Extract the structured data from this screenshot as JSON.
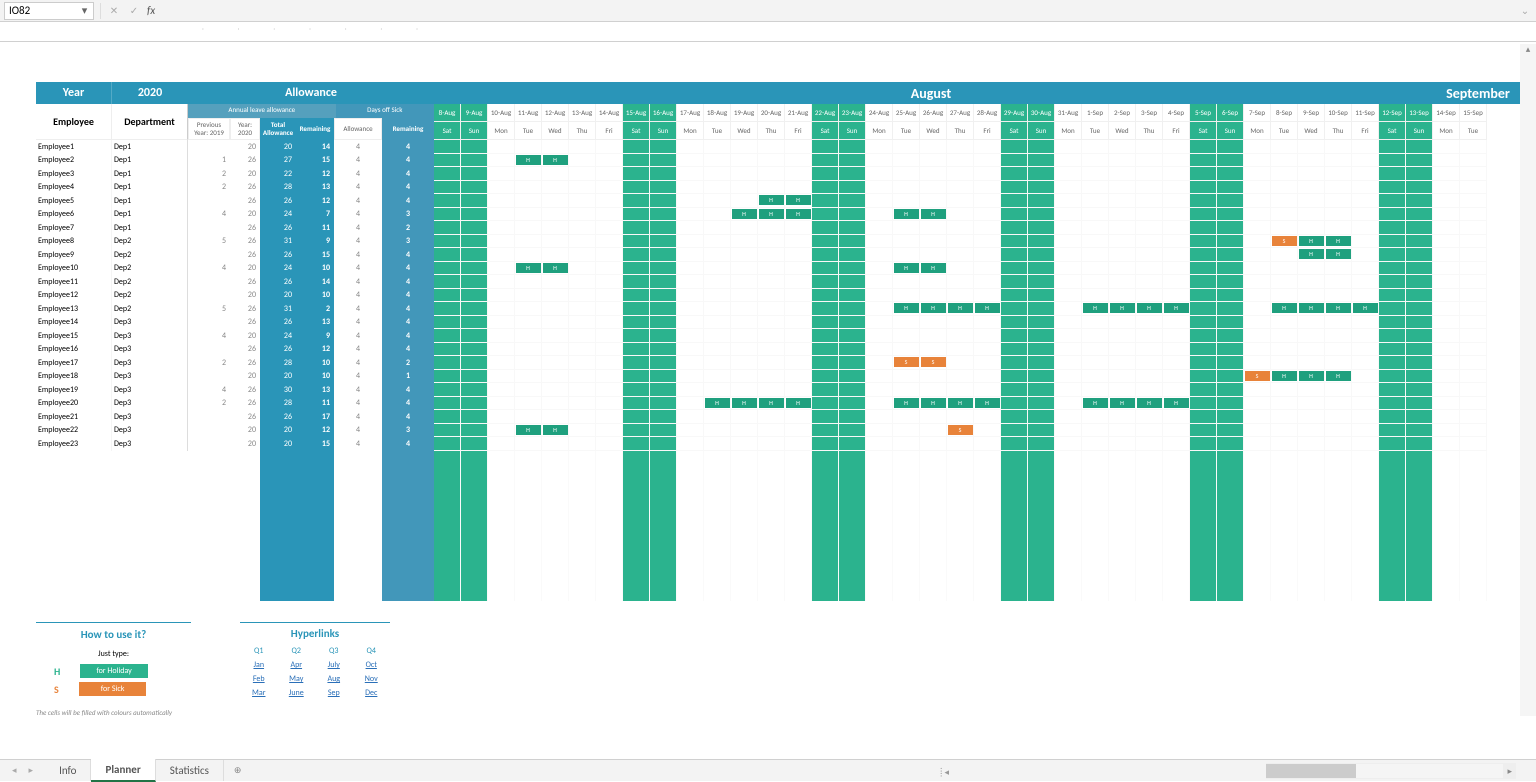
{
  "formula_bar": {
    "cell_ref": "IO82",
    "fx": "fx"
  },
  "header": {
    "year_label": "Year",
    "year_value": "2020",
    "allowance": "Allowance",
    "august": "August",
    "september": "September"
  },
  "sub": {
    "employee": "Employee",
    "department": "Department",
    "ala": "Annual leave allowance",
    "dos": "Days off Sick",
    "prev": "Previous Year: 2019",
    "y20": "Year: 2020",
    "tot": "Total Allowance",
    "rem": "Remaining",
    "sall": "Allowance",
    "srem": "Remaining"
  },
  "dates": [
    "8-Aug",
    "9-Aug",
    "10-Aug",
    "11-Aug",
    "12-Aug",
    "13-Aug",
    "14-Aug",
    "15-Aug",
    "16-Aug",
    "17-Aug",
    "18-Aug",
    "19-Aug",
    "20-Aug",
    "21-Aug",
    "22-Aug",
    "23-Aug",
    "24-Aug",
    "25-Aug",
    "26-Aug",
    "27-Aug",
    "28-Aug",
    "29-Aug",
    "30-Aug",
    "31-Aug",
    "1-Sep",
    "2-Sep",
    "3-Sep",
    "4-Sep",
    "5-Sep",
    "6-Sep",
    "7-Sep",
    "8-Sep",
    "9-Sep",
    "10-Sep",
    "11-Sep",
    "12-Sep",
    "13-Sep",
    "14-Sep",
    "15-Sep"
  ],
  "dows": [
    "Sat",
    "Sun",
    "Mon",
    "Tue",
    "Wed",
    "Thu",
    "Fri",
    "Sat",
    "Sun",
    "Mon",
    "Tue",
    "Wed",
    "Thu",
    "Fri",
    "Sat",
    "Sun",
    "Mon",
    "Tue",
    "Wed",
    "Thu",
    "Fri",
    "Sat",
    "Sun",
    "Mon",
    "Tue",
    "Wed",
    "Thu",
    "Fri",
    "Sat",
    "Sun",
    "Mon",
    "Tue",
    "Wed",
    "Thu",
    "Fri",
    "Sat",
    "Sun",
    "Mon",
    "Tue"
  ],
  "wknd_idx": [
    0,
    1,
    7,
    8,
    14,
    15,
    21,
    22,
    28,
    29,
    35,
    36
  ],
  "employees": [
    {
      "name": "Employee1",
      "dep": "Dep1",
      "prev": "",
      "y20": 20,
      "tot": 20,
      "rem": 14,
      "sa": 4,
      "sr": 4,
      "marks": []
    },
    {
      "name": "Employee2",
      "dep": "Dep1",
      "prev": 1,
      "y20": 26,
      "tot": 27,
      "rem": 15,
      "sa": 4,
      "sr": 4,
      "marks": [
        {
          "i": 3,
          "t": "H"
        },
        {
          "i": 4,
          "t": "H"
        }
      ]
    },
    {
      "name": "Employee3",
      "dep": "Dep1",
      "prev": 2,
      "y20": 20,
      "tot": 22,
      "rem": 12,
      "sa": 4,
      "sr": 4,
      "marks": []
    },
    {
      "name": "Employee4",
      "dep": "Dep1",
      "prev": 2,
      "y20": 26,
      "tot": 28,
      "rem": 13,
      "sa": 4,
      "sr": 4,
      "marks": []
    },
    {
      "name": "Employee5",
      "dep": "Dep1",
      "prev": "",
      "y20": 26,
      "tot": 26,
      "rem": 12,
      "sa": 4,
      "sr": 4,
      "marks": [
        {
          "i": 12,
          "t": "H"
        },
        {
          "i": 13,
          "t": "H"
        }
      ]
    },
    {
      "name": "Employee6",
      "dep": "Dep1",
      "prev": 4,
      "y20": 20,
      "tot": 24,
      "rem": 7,
      "sa": 4,
      "sr": 3,
      "marks": [
        {
          "i": 11,
          "t": "H"
        },
        {
          "i": 12,
          "t": "H"
        },
        {
          "i": 13,
          "t": "H"
        },
        {
          "i": 17,
          "t": "H"
        },
        {
          "i": 18,
          "t": "H"
        }
      ]
    },
    {
      "name": "Employee7",
      "dep": "Dep1",
      "prev": "",
      "y20": 26,
      "tot": 26,
      "rem": 11,
      "sa": 4,
      "sr": 2,
      "marks": []
    },
    {
      "name": "Employee8",
      "dep": "Dep2",
      "prev": 5,
      "y20": 26,
      "tot": 31,
      "rem": 9,
      "sa": 4,
      "sr": 3,
      "marks": [
        {
          "i": 31,
          "t": "S"
        },
        {
          "i": 32,
          "t": "H"
        },
        {
          "i": 33,
          "t": "H"
        }
      ]
    },
    {
      "name": "Employee9",
      "dep": "Dep2",
      "prev": "",
      "y20": 26,
      "tot": 26,
      "rem": 15,
      "sa": 4,
      "sr": 4,
      "marks": [
        {
          "i": 32,
          "t": "H"
        },
        {
          "i": 33,
          "t": "H"
        }
      ]
    },
    {
      "name": "Employee10",
      "dep": "Dep2",
      "prev": 4,
      "y20": 20,
      "tot": 24,
      "rem": 10,
      "sa": 4,
      "sr": 4,
      "marks": [
        {
          "i": 3,
          "t": "H"
        },
        {
          "i": 4,
          "t": "H"
        },
        {
          "i": 17,
          "t": "H"
        },
        {
          "i": 18,
          "t": "H"
        }
      ]
    },
    {
      "name": "Employee11",
      "dep": "Dep2",
      "prev": "",
      "y20": 26,
      "tot": 26,
      "rem": 14,
      "sa": 4,
      "sr": 4,
      "marks": []
    },
    {
      "name": "Employee12",
      "dep": "Dep2",
      "prev": "",
      "y20": 20,
      "tot": 20,
      "rem": 10,
      "sa": 4,
      "sr": 4,
      "marks": []
    },
    {
      "name": "Employee13",
      "dep": "Dep2",
      "prev": 5,
      "y20": 26,
      "tot": 31,
      "rem": 2,
      "sa": 4,
      "sr": 4,
      "marks": [
        {
          "i": 17,
          "t": "H"
        },
        {
          "i": 18,
          "t": "H"
        },
        {
          "i": 19,
          "t": "H"
        },
        {
          "i": 20,
          "t": "H"
        },
        {
          "i": 24,
          "t": "H"
        },
        {
          "i": 25,
          "t": "H"
        },
        {
          "i": 26,
          "t": "H"
        },
        {
          "i": 27,
          "t": "H"
        },
        {
          "i": 31,
          "t": "H"
        },
        {
          "i": 32,
          "t": "H"
        },
        {
          "i": 33,
          "t": "H"
        },
        {
          "i": 34,
          "t": "H"
        }
      ]
    },
    {
      "name": "Employee14",
      "dep": "Dep3",
      "prev": "",
      "y20": 26,
      "tot": 26,
      "rem": 13,
      "sa": 4,
      "sr": 4,
      "marks": []
    },
    {
      "name": "Employee15",
      "dep": "Dep3",
      "prev": 4,
      "y20": 20,
      "tot": 24,
      "rem": 9,
      "sa": 4,
      "sr": 4,
      "marks": []
    },
    {
      "name": "Employee16",
      "dep": "Dep3",
      "prev": "",
      "y20": 26,
      "tot": 26,
      "rem": 12,
      "sa": 4,
      "sr": 4,
      "marks": []
    },
    {
      "name": "Employee17",
      "dep": "Dep3",
      "prev": 2,
      "y20": 26,
      "tot": 28,
      "rem": 10,
      "sa": 4,
      "sr": 2,
      "marks": [
        {
          "i": 17,
          "t": "S"
        },
        {
          "i": 18,
          "t": "S"
        }
      ]
    },
    {
      "name": "Employee18",
      "dep": "Dep3",
      "prev": "",
      "y20": 20,
      "tot": 20,
      "rem": 10,
      "sa": 4,
      "sr": 1,
      "marks": [
        {
          "i": 30,
          "t": "S"
        },
        {
          "i": 31,
          "t": "H"
        },
        {
          "i": 32,
          "t": "H"
        },
        {
          "i": 33,
          "t": "H"
        }
      ]
    },
    {
      "name": "Employee19",
      "dep": "Dep3",
      "prev": 4,
      "y20": 26,
      "tot": 30,
      "rem": 13,
      "sa": 4,
      "sr": 4,
      "marks": []
    },
    {
      "name": "Employee20",
      "dep": "Dep3",
      "prev": 2,
      "y20": 26,
      "tot": 28,
      "rem": 11,
      "sa": 4,
      "sr": 4,
      "marks": [
        {
          "i": 10,
          "t": "H"
        },
        {
          "i": 11,
          "t": "H"
        },
        {
          "i": 12,
          "t": "H"
        },
        {
          "i": 13,
          "t": "H"
        },
        {
          "i": 17,
          "t": "H"
        },
        {
          "i": 18,
          "t": "H"
        },
        {
          "i": 19,
          "t": "H"
        },
        {
          "i": 20,
          "t": "H"
        },
        {
          "i": 24,
          "t": "H"
        },
        {
          "i": 25,
          "t": "H"
        },
        {
          "i": 26,
          "t": "H"
        },
        {
          "i": 27,
          "t": "H"
        }
      ]
    },
    {
      "name": "Employee21",
      "dep": "Dep3",
      "prev": "",
      "y20": 26,
      "tot": 26,
      "rem": 17,
      "sa": 4,
      "sr": 4,
      "marks": []
    },
    {
      "name": "Employee22",
      "dep": "Dep3",
      "prev": "",
      "y20": 20,
      "tot": 20,
      "rem": 12,
      "sa": 4,
      "sr": 3,
      "marks": [
        {
          "i": 3,
          "t": "H"
        },
        {
          "i": 4,
          "t": "H"
        },
        {
          "i": 19,
          "t": "S"
        }
      ]
    },
    {
      "name": "Employee23",
      "dep": "Dep3",
      "prev": "",
      "y20": 20,
      "tot": 20,
      "rem": 15,
      "sa": 4,
      "sr": 4,
      "marks": []
    }
  ],
  "legend": {
    "title": "How to use it?",
    "just_type": "Just type:",
    "h": "H",
    "h_label": "for Holiday",
    "s": "S",
    "s_label": "for Sick",
    "note": "The cells will be filled with colours automatically"
  },
  "hyper": {
    "title": "Hyperlinks",
    "q": [
      "Q1",
      "Q2",
      "Q3",
      "Q4"
    ],
    "rows": [
      [
        "Jan",
        "Apr",
        "July",
        "Oct"
      ],
      [
        "Feb",
        "May",
        "Aug",
        "Nov"
      ],
      [
        "Mar",
        "June",
        "Sep",
        "Dec"
      ]
    ]
  },
  "tabs": {
    "info": "Info",
    "planner": "Planner",
    "stats": "Statistics"
  }
}
